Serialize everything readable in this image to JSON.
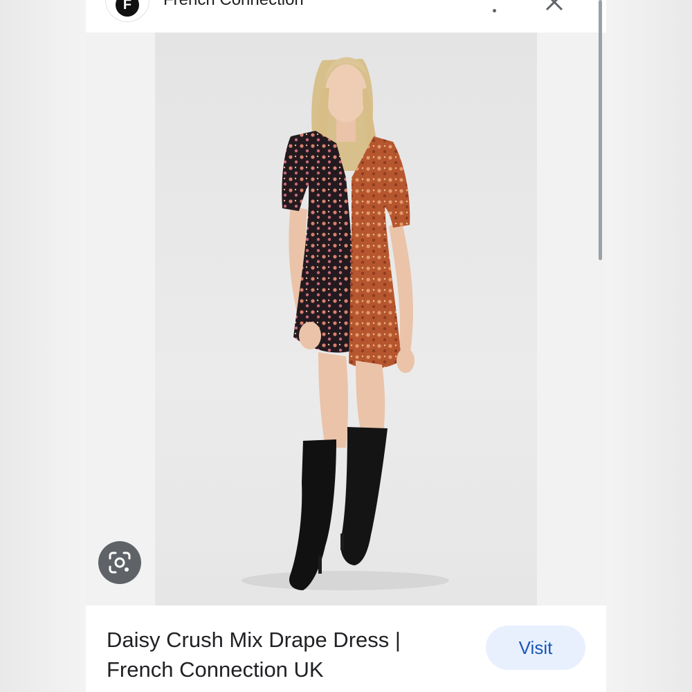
{
  "header": {
    "site_name": "French Connection",
    "logo_letter": "F",
    "icons": {
      "more": "more-vert-icon",
      "close": "close-icon"
    }
  },
  "image": {
    "lens_icon": "google-lens-icon"
  },
  "result": {
    "title": "Daisy Crush Mix Drape Dress | French Connection UK",
    "visit_label": "Visit"
  },
  "colors": {
    "visit_bg": "#e8f0fe",
    "visit_text": "#1a57b4",
    "lens_bg": "#5f6368"
  }
}
